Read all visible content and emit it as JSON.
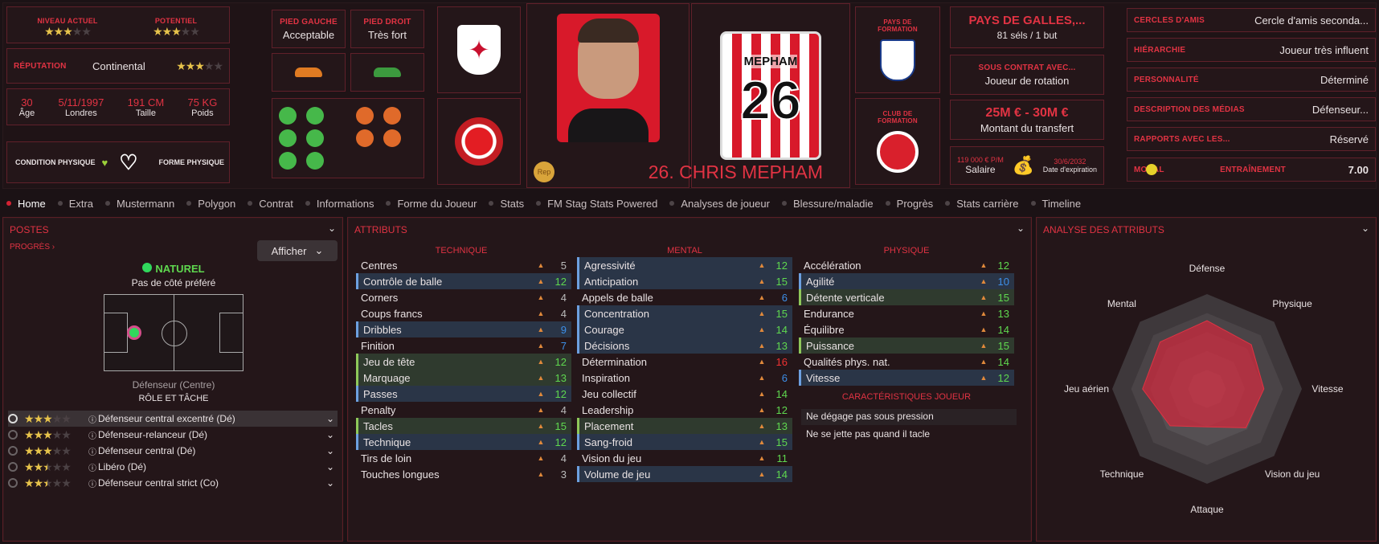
{
  "ratings": {
    "current_label": "NIVEAU ACTUEL",
    "current_stars": 3,
    "potential_label": "POTENTIEL",
    "potential_stars": 3
  },
  "reputation": {
    "label": "RÉPUTATION",
    "value": "Continental",
    "stars": 3
  },
  "bio": {
    "age": "30",
    "age_label": "Âge",
    "birth": "5/11/1997",
    "birthplace": "Londres",
    "height": "191 CM",
    "height_label": "Taille",
    "weight": "75 KG",
    "weight_label": "Poids"
  },
  "condition": {
    "label": "CONDITION PHYSIQUE",
    "form_label": "FORME PHYSIQUE"
  },
  "feet": {
    "left_label": "PIED GAUCHE",
    "left_value": "Acceptable",
    "right_label": "PIED DROIT",
    "right_value": "Très fort"
  },
  "player": {
    "name": "26. CHRIS MEPHAM",
    "shirt_name": "MEPHAM",
    "shirt_number": "26",
    "rep_badge": "Rep"
  },
  "formation_country": {
    "label": "PAYS DE FORMATION"
  },
  "formation_club": {
    "label": "CLUB DE FORMATION"
  },
  "nation": {
    "title": "PAYS DE GALLES,...",
    "caps": "81 séls / 1 but"
  },
  "contract": {
    "label": "SOUS CONTRAT AVEC...",
    "value": "Joueur de rotation"
  },
  "transfer": {
    "value": "25M € - 30M €",
    "label": "Montant du transfert"
  },
  "salary": {
    "value": "119 000 € P/M",
    "label": "Salaire",
    "expiry": "30/6/2032",
    "expiry_label": "Date d'expiration"
  },
  "info_rows": [
    {
      "label": "CERCLES D'AMIS",
      "value": "Cercle d'amis seconda..."
    },
    {
      "label": "HIÉRARCHIE",
      "value": "Joueur très influent"
    },
    {
      "label": "PERSONNALITÉ",
      "value": "Déterminé"
    },
    {
      "label": "DESCRIPTION DES MÉDIAS",
      "value": "Défenseur..."
    },
    {
      "label": "RAPPORTS AVEC LES...",
      "value": "Réservé"
    }
  ],
  "morale": {
    "label": "MORAL",
    "training_label": "ENTRAÎNEMENT",
    "training_value": "7.00"
  },
  "tabs": [
    "Home",
    "Extra",
    "Mustermann",
    "Polygon",
    "Contrat",
    "Informations",
    "Forme du Joueur",
    "Stats",
    "FM Stag Stats Powered",
    "Analyses de joueur",
    "Blessure/maladie",
    "Progrès",
    "Stats carrière",
    "Timeline"
  ],
  "positions": {
    "title": "POSTES",
    "progress_link": "PROGRÈS",
    "show_button": "Afficher",
    "natural": "NATUREL",
    "side_text": "Pas de côté préféré",
    "position_name": "Défenseur (Centre)",
    "role_title": "RÔLE ET TÂCHE",
    "roles": [
      {
        "name": "Défenseur central excentré (Dé)",
        "stars": 3
      },
      {
        "name": "Défenseur-relanceur (Dé)",
        "stars": 3
      },
      {
        "name": "Défenseur central (Dé)",
        "stars": 3
      },
      {
        "name": "Libéro (Dé)",
        "stars": 2.5
      },
      {
        "name": "Défenseur central strict (Co)",
        "stars": 2.5
      }
    ]
  },
  "attributes": {
    "title": "ATTRIBUTS",
    "technique_title": "TECHNIQUE",
    "mental_title": "MENTAL",
    "physique_title": "PHYSIQUE",
    "technique": [
      {
        "n": "Centres",
        "v": "5",
        "c": "w",
        "h": ""
      },
      {
        "n": "Contrôle de balle",
        "v": "12",
        "c": "g",
        "h": "hl"
      },
      {
        "n": "Corners",
        "v": "4",
        "c": "w",
        "h": ""
      },
      {
        "n": "Coups francs",
        "v": "4",
        "c": "w",
        "h": ""
      },
      {
        "n": "Dribbles",
        "v": "9",
        "c": "b",
        "h": "hl"
      },
      {
        "n": "Finition",
        "v": "7",
        "c": "b",
        "h": ""
      },
      {
        "n": "Jeu de tête",
        "v": "12",
        "c": "g",
        "h": "hlg"
      },
      {
        "n": "Marquage",
        "v": "13",
        "c": "g",
        "h": "hlg"
      },
      {
        "n": "Passes",
        "v": "12",
        "c": "g",
        "h": "hl"
      },
      {
        "n": "Penalty",
        "v": "4",
        "c": "w",
        "h": ""
      },
      {
        "n": "Tacles",
        "v": "15",
        "c": "g",
        "h": "hlg"
      },
      {
        "n": "Technique",
        "v": "12",
        "c": "g",
        "h": "hl"
      },
      {
        "n": "Tirs de loin",
        "v": "4",
        "c": "w",
        "h": ""
      },
      {
        "n": "Touches longues",
        "v": "3",
        "c": "w",
        "h": ""
      }
    ],
    "mental": [
      {
        "n": "Agressivité",
        "v": "12",
        "c": "g",
        "h": "hl"
      },
      {
        "n": "Anticipation",
        "v": "15",
        "c": "g",
        "h": "hl"
      },
      {
        "n": "Appels de balle",
        "v": "6",
        "c": "b",
        "h": ""
      },
      {
        "n": "Concentration",
        "v": "15",
        "c": "g",
        "h": "hl"
      },
      {
        "n": "Courage",
        "v": "14",
        "c": "g",
        "h": "hl"
      },
      {
        "n": "Décisions",
        "v": "13",
        "c": "g",
        "h": "hl"
      },
      {
        "n": "Détermination",
        "v": "16",
        "c": "r",
        "h": ""
      },
      {
        "n": "Inspiration",
        "v": "6",
        "c": "b",
        "h": ""
      },
      {
        "n": "Jeu collectif",
        "v": "14",
        "c": "g",
        "h": ""
      },
      {
        "n": "Leadership",
        "v": "12",
        "c": "g",
        "h": ""
      },
      {
        "n": "Placement",
        "v": "13",
        "c": "g",
        "h": "hlg"
      },
      {
        "n": "Sang-froid",
        "v": "15",
        "c": "g",
        "h": "hl"
      },
      {
        "n": "Vision du jeu",
        "v": "11",
        "c": "g",
        "h": ""
      },
      {
        "n": "Volume de jeu",
        "v": "14",
        "c": "g",
        "h": "hl"
      }
    ],
    "physique": [
      {
        "n": "Accélération",
        "v": "12",
        "c": "g",
        "h": ""
      },
      {
        "n": "Agilité",
        "v": "10",
        "c": "b",
        "h": "hl"
      },
      {
        "n": "Détente verticale",
        "v": "15",
        "c": "g",
        "h": "hlg"
      },
      {
        "n": "Endurance",
        "v": "13",
        "c": "g",
        "h": ""
      },
      {
        "n": "Équilibre",
        "v": "14",
        "c": "g",
        "h": ""
      },
      {
        "n": "Puissance",
        "v": "15",
        "c": "g",
        "h": "hlg"
      },
      {
        "n": "Qualités phys. nat.",
        "v": "14",
        "c": "g",
        "h": ""
      },
      {
        "n": "Vitesse",
        "v": "12",
        "c": "g",
        "h": "hl"
      }
    ],
    "traits_title": "CARACTÉRISTIQUES JOUEUR",
    "traits": [
      "Ne dégage pas sous pression",
      "Ne se jette pas quand il tacle"
    ]
  },
  "analysis": {
    "title": "ANALYSE DES ATTRIBUTS",
    "axes": [
      "Défense",
      "Physique",
      "Vitesse",
      "Vision du jeu",
      "Attaque",
      "Technique",
      "Jeu aérien",
      "Mental"
    ],
    "values": [
      0.72,
      0.66,
      0.6,
      0.58,
      0.4,
      0.55,
      0.68,
      0.7
    ]
  },
  "colors": {
    "accent": "#e13343",
    "green": "#5fd84f",
    "blue": "#3d8fe8"
  }
}
